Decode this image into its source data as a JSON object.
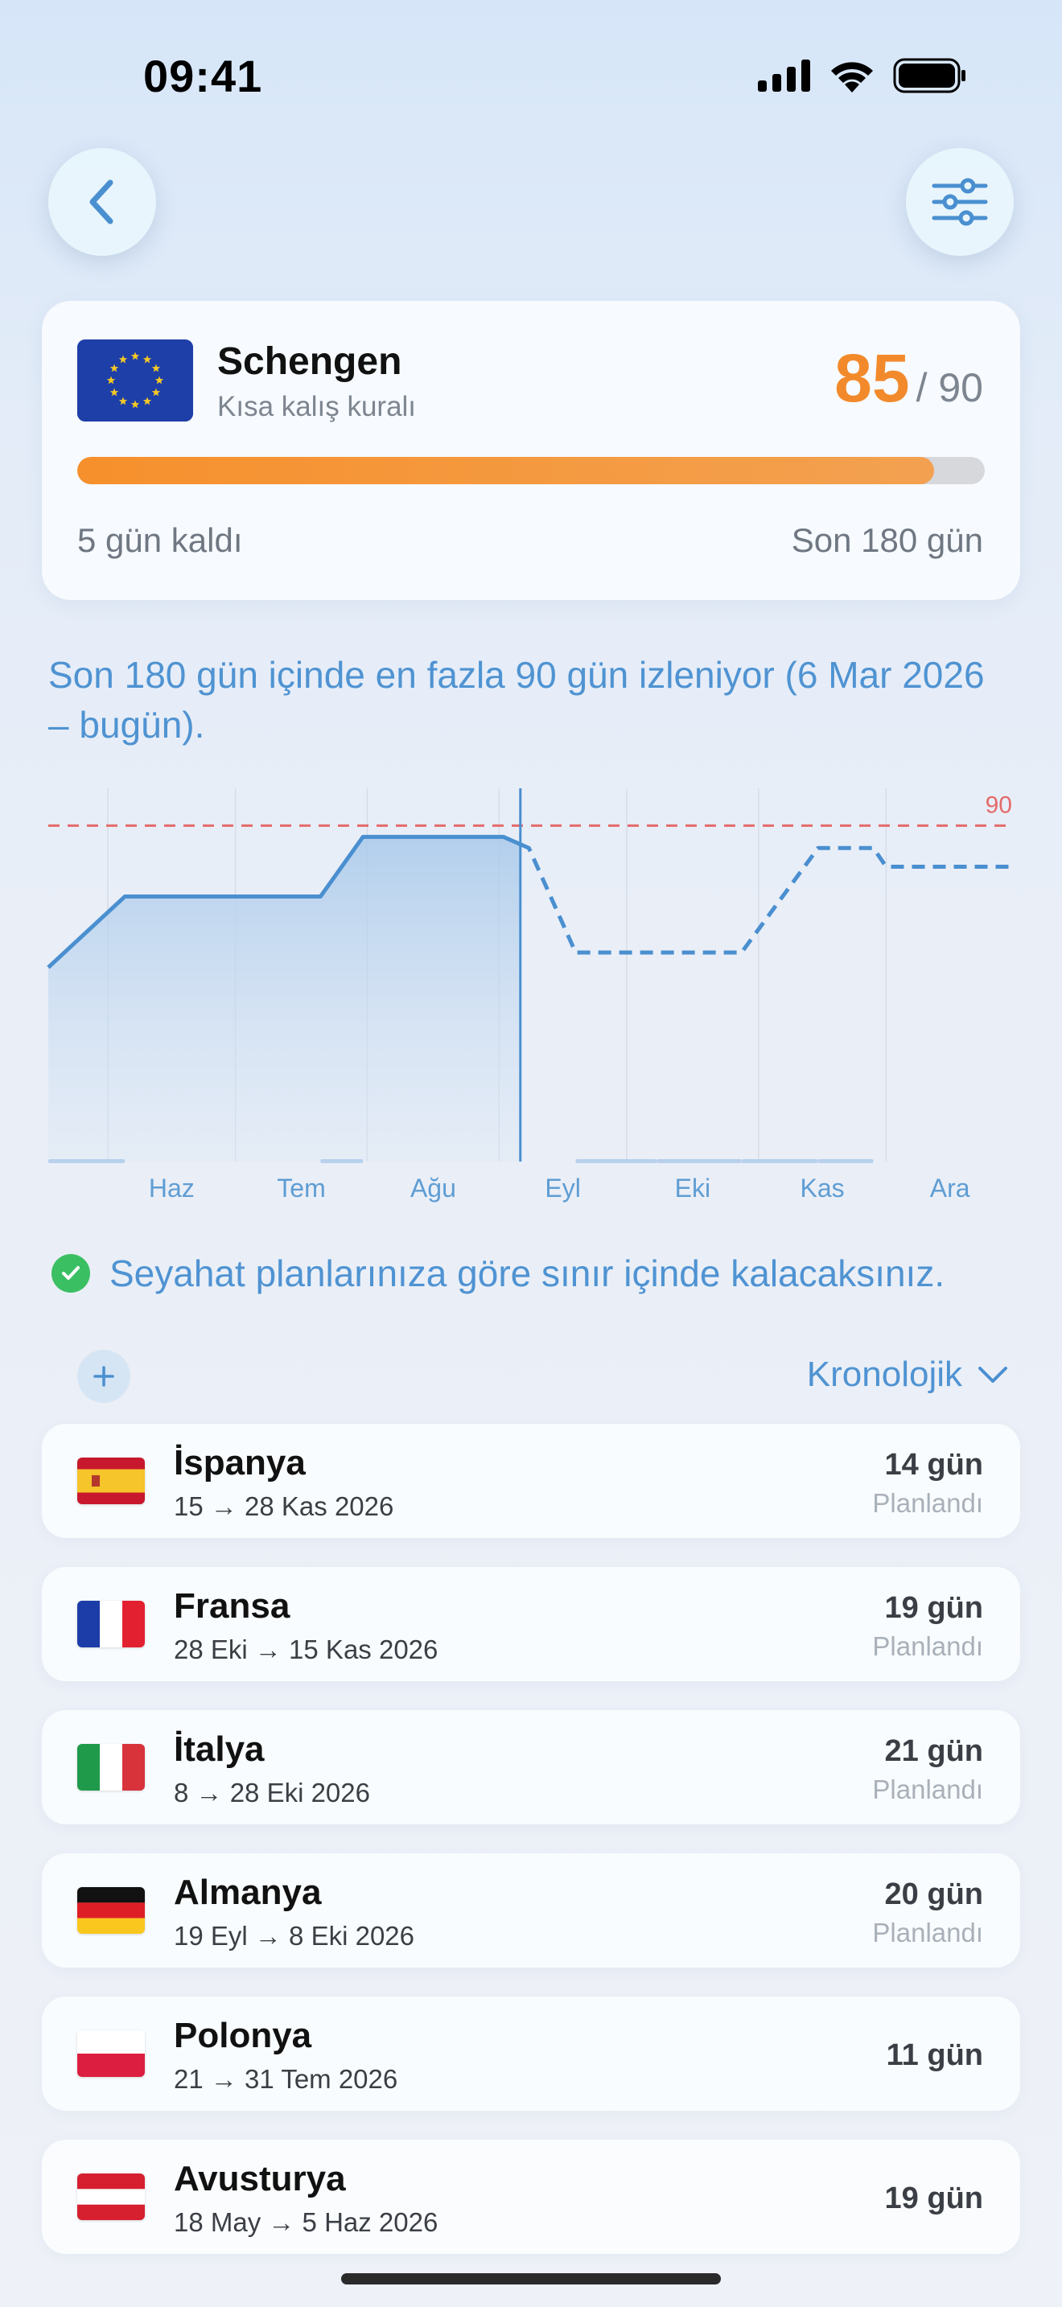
{
  "status_bar": {
    "time": "09:41"
  },
  "header": {
    "back_icon": "chevron-left-icon",
    "filter_icon": "sliders-icon"
  },
  "summary": {
    "title": "Schengen",
    "subtitle": "Kısa kalış kuralı",
    "used_days": "85",
    "max_days": "/ 90",
    "progress_fraction": 0.944,
    "remaining": "5 gün kaldı",
    "window": "Son 180 gün",
    "colors": {
      "accent": "#f28a2c",
      "track": "#d6d8dc"
    }
  },
  "info_text": "Son 180 gün içinde en fazla 90 gün izleniyor (6 Mar 2026 – bugün).",
  "chart_data": {
    "type": "line",
    "title": "",
    "xlabel": "",
    "ylabel": "",
    "x_ticks": [
      "Haz",
      "Tem",
      "Ağu",
      "Eyl",
      "Eki",
      "Kas",
      "Ara"
    ],
    "limit": 90,
    "limit_label": "90",
    "ylim": [
      0,
      100
    ],
    "xlim": [
      "2026-05-18",
      "2026-12-31"
    ],
    "today": "2026-09-06",
    "series": [
      {
        "style": "solid-area",
        "x": [
          "2026-05-18",
          "2026-06-05",
          "2026-07-21",
          "2026-07-31",
          "2026-09-02",
          "2026-09-06"
        ],
        "y": [
          52,
          71,
          71,
          87,
          87,
          85
        ]
      },
      {
        "style": "dashed",
        "x": [
          "2026-09-06",
          "2026-09-08",
          "2026-09-19",
          "2026-10-28",
          "2026-11-15",
          "2026-11-28",
          "2026-12-01",
          "2026-12-31"
        ],
        "y": [
          85,
          84,
          56,
          56,
          84,
          84,
          79,
          79
        ]
      }
    ],
    "colors": {
      "line": "#4a8fd0",
      "limit": "#e46b6b",
      "area": "#b9d3ee"
    }
  },
  "status_message": "Seyahat planlarınıza göre sınır içinde kalacaksınız.",
  "list_controls": {
    "add_icon": "plus-icon",
    "sort_label": "Kronolojik",
    "sort_icon": "chevron-down-icon"
  },
  "trips": [
    {
      "country": "İspanya",
      "dates": "15 → 28 Kas 2026",
      "days": "14 gün",
      "status": "Planlandı",
      "flag": "spain-flag"
    },
    {
      "country": "Fransa",
      "dates": "28 Eki → 15 Kas 2026",
      "days": "19 gün",
      "status": "Planlandı",
      "flag": "france-flag"
    },
    {
      "country": "İtalya",
      "dates": "8 → 28 Eki 2026",
      "days": "21 gün",
      "status": "Planlandı",
      "flag": "italy-flag"
    },
    {
      "country": "Almanya",
      "dates": "19 Eyl → 8 Eki 2026",
      "days": "20 gün",
      "status": "Planlandı",
      "flag": "germany-flag"
    },
    {
      "country": "Polonya",
      "dates": "21 → 31 Tem 2026",
      "days": "11 gün",
      "status": "",
      "flag": "poland-flag"
    },
    {
      "country": "Avusturya",
      "dates": "18 May → 5 Haz 2026",
      "days": "19 gün",
      "status": "",
      "flag": "austria-flag"
    }
  ]
}
